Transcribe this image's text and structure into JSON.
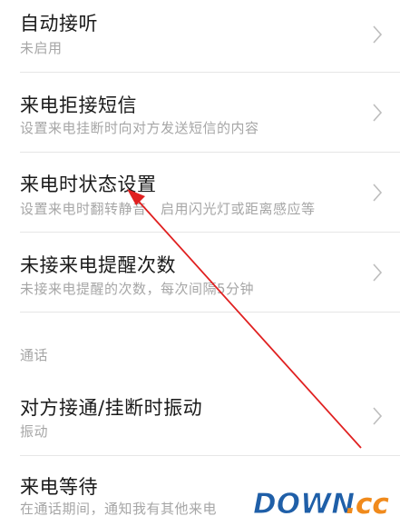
{
  "settings": {
    "items": [
      {
        "title": "自动接听",
        "subtitle": "未启用"
      },
      {
        "title": "来电拒接短信",
        "subtitle": "设置来电挂断时向对方发送短信的内容"
      },
      {
        "title": "来电时状态设置",
        "subtitle": "设置来电时翻转静音、启用闪光灯或距离感应等"
      },
      {
        "title": "未接来电提醒次数",
        "subtitle": "未接来电提醒的次数，每次间隔5分钟"
      }
    ],
    "section_header": "通话",
    "call_items": [
      {
        "title": "对方接通/挂断时振动",
        "subtitle": "振动"
      },
      {
        "title": "来电等待",
        "subtitle": "在通话期间，通知我有其他来电"
      }
    ]
  },
  "watermark": {
    "text_main": "DOWN",
    "text_dot": ".",
    "text_tld": "cc"
  },
  "colors": {
    "annotation_arrow": "#e02020",
    "watermark_blue": "#1f5fa8",
    "watermark_orange": "#f08a1c"
  }
}
